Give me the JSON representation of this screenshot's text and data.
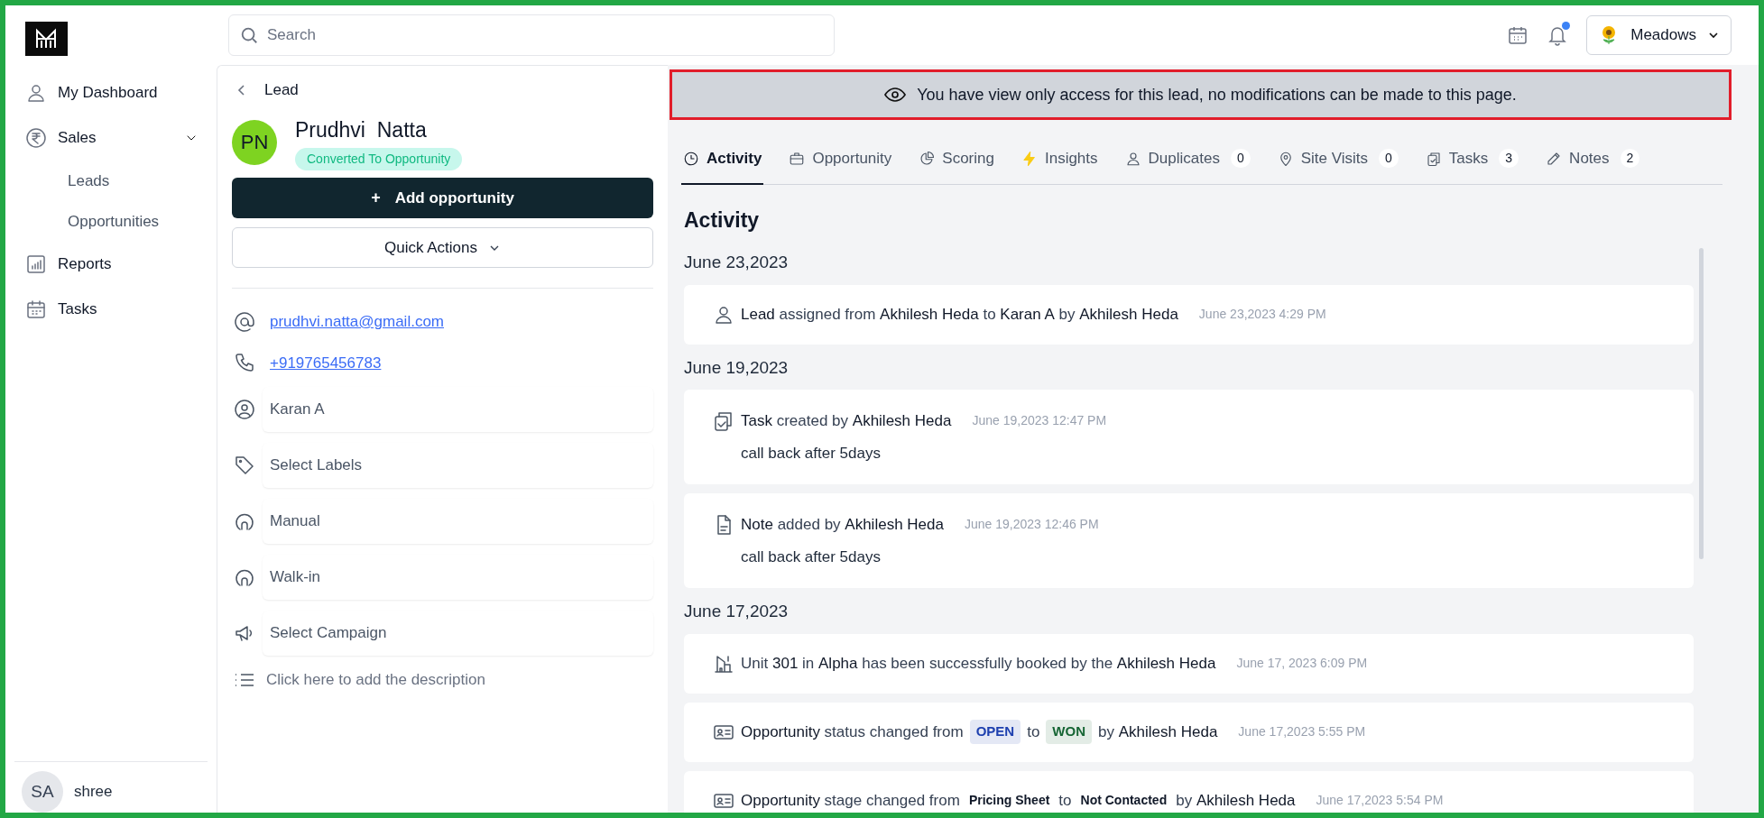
{
  "search": {
    "placeholder": "Search"
  },
  "workspace": {
    "name": "Meadows"
  },
  "notifications": {
    "unread": true
  },
  "sidebar": {
    "items": [
      {
        "label": "My Dashboard"
      },
      {
        "label": "Sales",
        "expanded": true,
        "children": [
          {
            "label": "Leads"
          },
          {
            "label": "Opportunities"
          }
        ]
      },
      {
        "label": "Reports"
      },
      {
        "label": "Tasks"
      }
    ],
    "user": {
      "initials": "SA",
      "name": "shree"
    }
  },
  "lead": {
    "back_label": "Lead",
    "initials": "PN",
    "name": "Prudhvi  Natta",
    "status": "Converted To Opportunity",
    "add_button": "Add opportunity",
    "add_icon": "+",
    "quick_actions": "Quick Actions",
    "contacts": [
      {
        "kind": "email",
        "text": "prudhvi.natta@gmail.com"
      },
      {
        "kind": "phone",
        "text": "+919765456783"
      }
    ],
    "fields": [
      {
        "kind": "owner",
        "text": "Karan A"
      },
      {
        "kind": "labels",
        "text": "Select Labels"
      },
      {
        "kind": "source",
        "text": "Manual"
      },
      {
        "kind": "source",
        "text": "Walk-in"
      },
      {
        "kind": "campaign",
        "text": "Select Campaign"
      }
    ],
    "description": "Click here to add the description"
  },
  "banner": {
    "text": "You have view only access for this lead, no modifications can be made to this page."
  },
  "tabs": [
    {
      "label": "Activity",
      "selected": true
    },
    {
      "label": "Opportunity",
      "selected": false
    },
    {
      "label": "Scoring",
      "selected": false
    },
    {
      "label": "Insights",
      "selected": false
    },
    {
      "label": "Duplicates",
      "selected": false,
      "count": "0"
    },
    {
      "label": "Site Visits",
      "selected": false,
      "count": "0"
    },
    {
      "label": "Tasks",
      "selected": false,
      "count": "3"
    },
    {
      "label": "Notes",
      "selected": false,
      "count": "2"
    }
  ],
  "activity": {
    "title": "Activity",
    "groups": [
      {
        "date": "June 23,2023",
        "items": [
          {
            "kind": "assignment",
            "parts": [
              {
                "kind": "text",
                "text": "**Lead** assigned from **Akhilesh Heda** to **Karan A** by **Akhilesh Heda**"
              }
            ],
            "time": "June 23,2023 4:29 PM"
          }
        ]
      },
      {
        "date": "June 19,2023",
        "items": [
          {
            "kind": "task",
            "parts": [
              {
                "kind": "text",
                "text": "**Task** created by **Akhilesh Heda**"
              }
            ],
            "time": "June 19,2023 12:47 PM",
            "note": "call back after 5days"
          },
          {
            "kind": "note",
            "parts": [
              {
                "kind": "text",
                "text": "**Note** added by **Akhilesh Heda**"
              }
            ],
            "time": "June 19,2023 12:46 PM",
            "note": "call back after 5days"
          }
        ]
      },
      {
        "date": "June 17,2023",
        "items": [
          {
            "kind": "booking",
            "parts": [
              {
                "kind": "text",
                "text": "Unit **301** in **Alpha** has been successfully booked by the **Akhilesh Heda**"
              }
            ],
            "time": "June 17, 2023 6:09 PM"
          },
          {
            "kind": "opportunity",
            "parts": [
              {
                "kind": "text",
                "text": "**Opportunity** status changed from"
              },
              {
                "kind": "badge",
                "text": "OPEN",
                "color": "#1e40af"
              },
              {
                "kind": "text",
                "text": "to"
              },
              {
                "kind": "badge",
                "text": "WON",
                "color": "#166534"
              },
              {
                "kind": "text",
                "text": "by **Akhilesh Heda**"
              }
            ],
            "time": "June 17,2023 5:55 PM"
          },
          {
            "kind": "opportunity",
            "parts": [
              {
                "kind": "text",
                "text": "**Opportunity** stage changed from"
              },
              {
                "kind": "label",
                "text": "Pricing Sheet"
              },
              {
                "kind": "text",
                "text": "to"
              },
              {
                "kind": "label",
                "text": "Not Contacted"
              },
              {
                "kind": "text",
                "text": "by **Akhilesh Heda**"
              }
            ],
            "time": "June 17,2023 5:54 PM"
          }
        ]
      }
    ]
  }
}
